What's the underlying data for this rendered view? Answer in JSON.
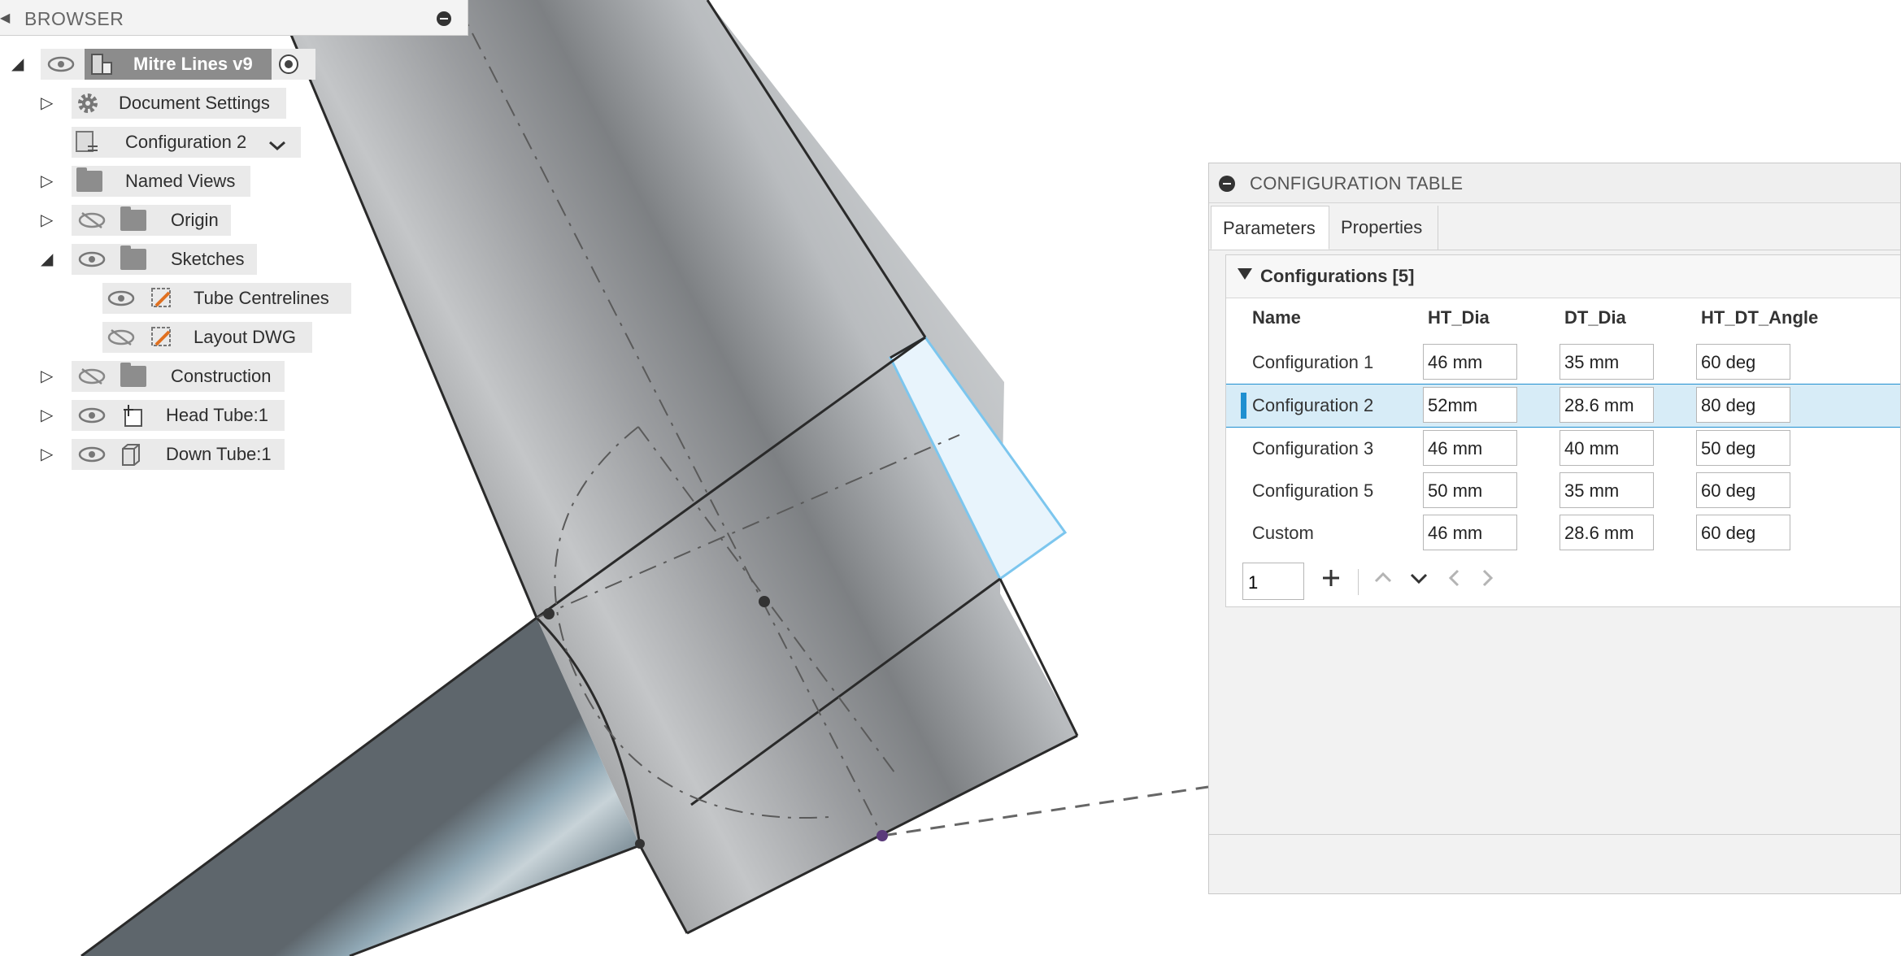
{
  "browser": {
    "title": "BROWSER",
    "root_label": "Mitre Lines v9",
    "items": [
      {
        "label": "Document Settings"
      },
      {
        "label": "Configuration 2"
      },
      {
        "label": "Named Views"
      },
      {
        "label": "Origin"
      },
      {
        "label": "Sketches"
      },
      {
        "label": "Tube Centrelines"
      },
      {
        "label": "Layout DWG"
      },
      {
        "label": "Construction"
      },
      {
        "label": "Head Tube:1"
      },
      {
        "label": "Down Tube:1"
      }
    ]
  },
  "config_table": {
    "title": "CONFIGURATION TABLE",
    "tabs": [
      {
        "label": "Parameters"
      },
      {
        "label": "Properties"
      }
    ],
    "section_label": "Configurations [5]",
    "columns": [
      "Name",
      "HT_Dia",
      "DT_Dia",
      "HT_DT_Angle"
    ],
    "rows": [
      {
        "name": "Configuration 1",
        "ht_dia": "46 mm",
        "dt_dia": "35 mm",
        "angle": "60 deg"
      },
      {
        "name": "Configuration 2",
        "ht_dia": "52mm",
        "dt_dia": "28.6 mm",
        "angle": "80 deg"
      },
      {
        "name": "Configuration 3",
        "ht_dia": "46 mm",
        "dt_dia": "40 mm",
        "angle": "50 deg"
      },
      {
        "name": "Configuration 5",
        "ht_dia": "50 mm",
        "dt_dia": "35 mm",
        "angle": "60 deg"
      },
      {
        "name": "Custom",
        "ht_dia": "46 mm",
        "dt_dia": "28.6 mm",
        "angle": "60 deg"
      }
    ],
    "add_count": "1",
    "selected_row": "Configuration 2"
  },
  "colors": {
    "accent": "#1f8fd0",
    "selection_bg": "#d7ecf7",
    "panel_bg": "#f2f2f2",
    "tube_highlight": "#e8f4fc"
  },
  "icons": [
    "eye-icon",
    "hidden-eye-icon",
    "gear-icon",
    "folder-icon",
    "sketch-icon",
    "body-icon",
    "component-icon",
    "chevron-down-icon",
    "radio-icon",
    "plus-icon",
    "arrow-up-icon",
    "arrow-down-icon",
    "arrow-left-icon",
    "arrow-right-icon"
  ]
}
